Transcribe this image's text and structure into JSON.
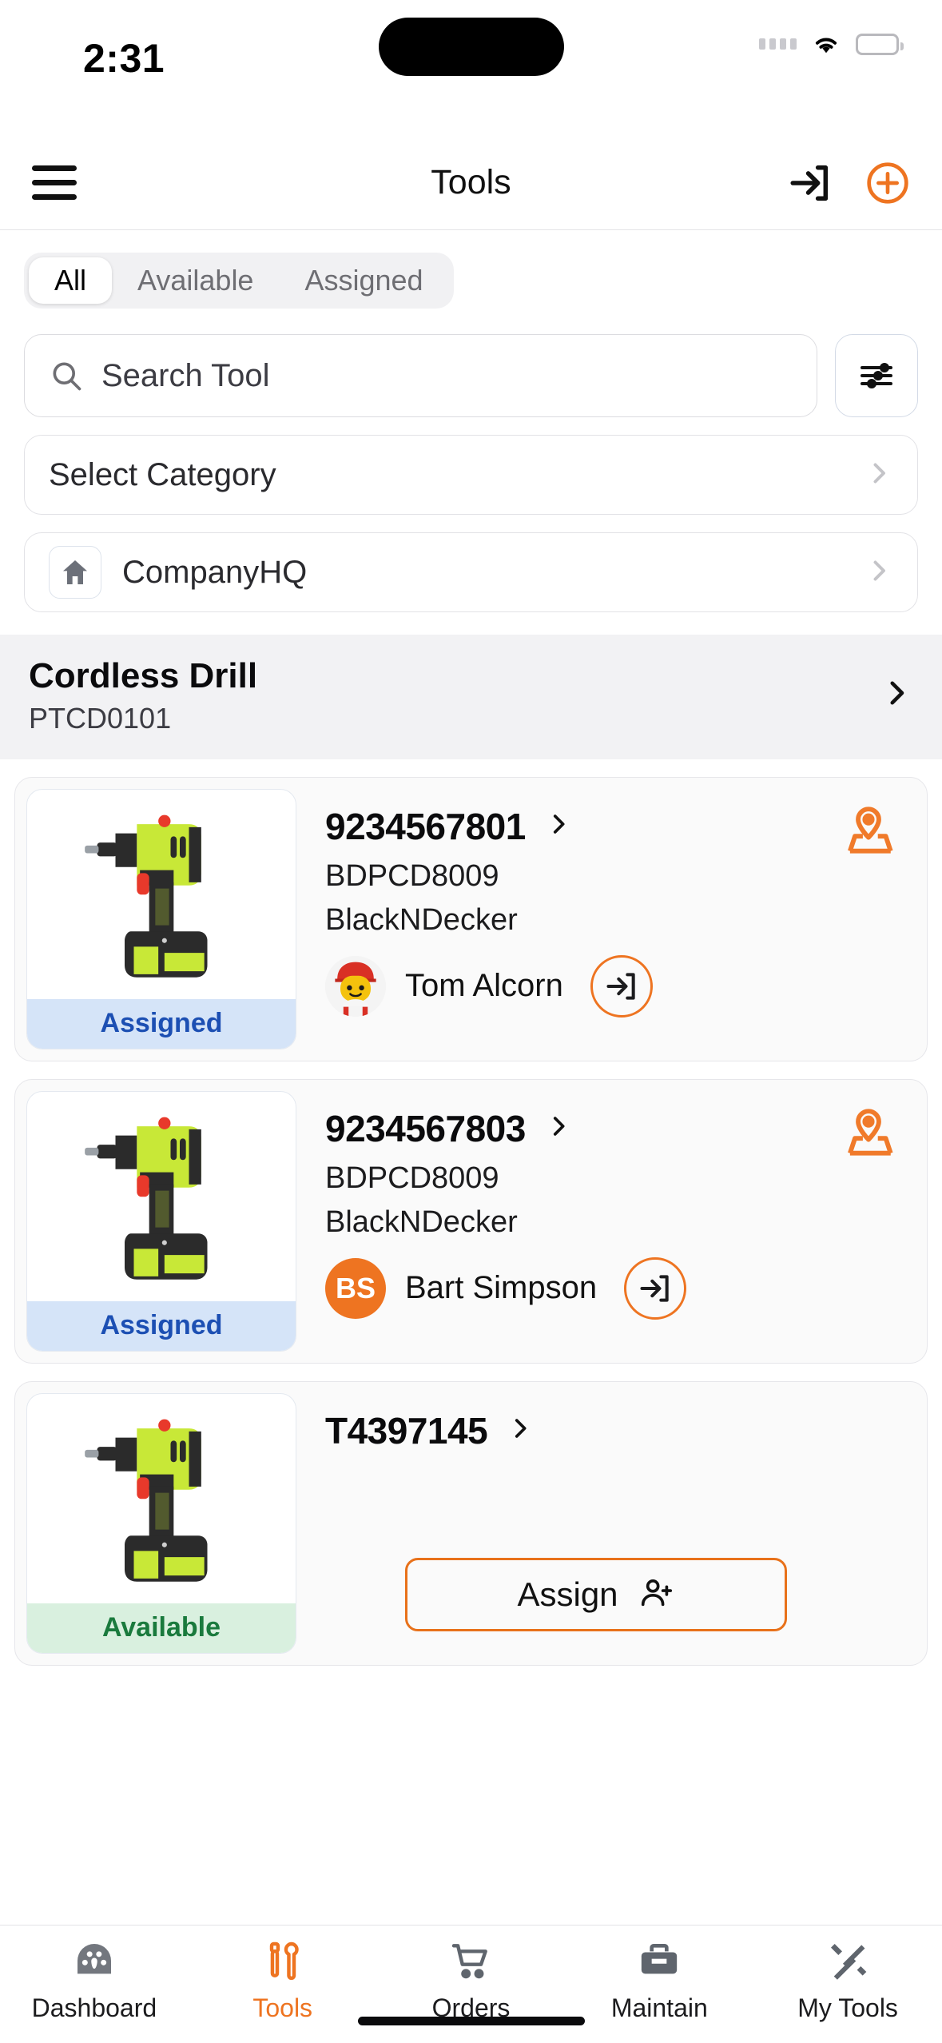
{
  "status_bar": {
    "time": "2:31",
    "wifi_icon": "wifi-icon",
    "battery_icon": "battery-icon",
    "signal_icon": "signal-dots-icon"
  },
  "header": {
    "title": "Tools",
    "menu_icon": "hamburger-menu-icon",
    "checkin_icon": "check-in-arrow-icon",
    "add_icon": "add-circle-icon"
  },
  "segmented": {
    "items": [
      {
        "label": "All",
        "active": true
      },
      {
        "label": "Available",
        "active": false
      },
      {
        "label": "Assigned",
        "active": false
      }
    ]
  },
  "search": {
    "placeholder": "Search Tool",
    "icon": "search-icon",
    "filter_icon": "filter-sliders-icon"
  },
  "category_select": {
    "label": "Select Category",
    "chevron_icon": "chevron-right-icon"
  },
  "location_select": {
    "label": "CompanyHQ",
    "icon": "home-icon",
    "chevron_icon": "chevron-right-icon"
  },
  "group_header": {
    "title": "Cordless Drill",
    "subtitle": "PTCD0101",
    "chevron_icon": "chevron-right-icon"
  },
  "tools": [
    {
      "serial": "9234567801",
      "model": "BDPCD8009",
      "brand": "BlackNDecker",
      "status": "Assigned",
      "status_type": "assigned",
      "assignee": "Tom Alcorn",
      "avatar_type": "photo",
      "avatar_initials": "",
      "action": "checkin",
      "location_icon": "map-pin-icon",
      "chevron_icon": "chevron-right-icon",
      "checkin_icon": "check-in-arrow-icon",
      "thumbnail": "cordless-drill-photo"
    },
    {
      "serial": "9234567803",
      "model": "BDPCD8009",
      "brand": "BlackNDecker",
      "status": "Assigned",
      "status_type": "assigned",
      "assignee": "Bart Simpson",
      "avatar_type": "initials",
      "avatar_initials": "BS",
      "action": "checkin",
      "location_icon": "map-pin-icon",
      "chevron_icon": "chevron-right-icon",
      "checkin_icon": "check-in-arrow-icon",
      "thumbnail": "cordless-drill-photo"
    },
    {
      "serial": "T4397145",
      "model": "",
      "brand": "",
      "status": "Available",
      "status_type": "available",
      "assignee": "",
      "avatar_type": "none",
      "avatar_initials": "",
      "action": "assign",
      "assign_label": "Assign",
      "assign_icon": "person-add-icon",
      "chevron_icon": "chevron-right-icon",
      "thumbnail": "cordless-drill-photo"
    }
  ],
  "tabbar": {
    "items": [
      {
        "label": "Dashboard",
        "icon": "dashboard-gauge-icon",
        "active": false
      },
      {
        "label": "Tools",
        "icon": "tools-screwdriver-wrench-icon",
        "active": true
      },
      {
        "label": "Orders",
        "icon": "shopping-cart-icon",
        "active": false
      },
      {
        "label": "Maintain",
        "icon": "toolbox-icon",
        "active": false
      },
      {
        "label": "My Tools",
        "icon": "crossed-tools-icon",
        "active": false
      }
    ]
  },
  "colors": {
    "accent": "#ee7421",
    "assigned_bg": "#d5e4f8",
    "assigned_text": "#1c4fb3",
    "available_bg": "#d9f0df",
    "available_text": "#1a7a3d"
  }
}
